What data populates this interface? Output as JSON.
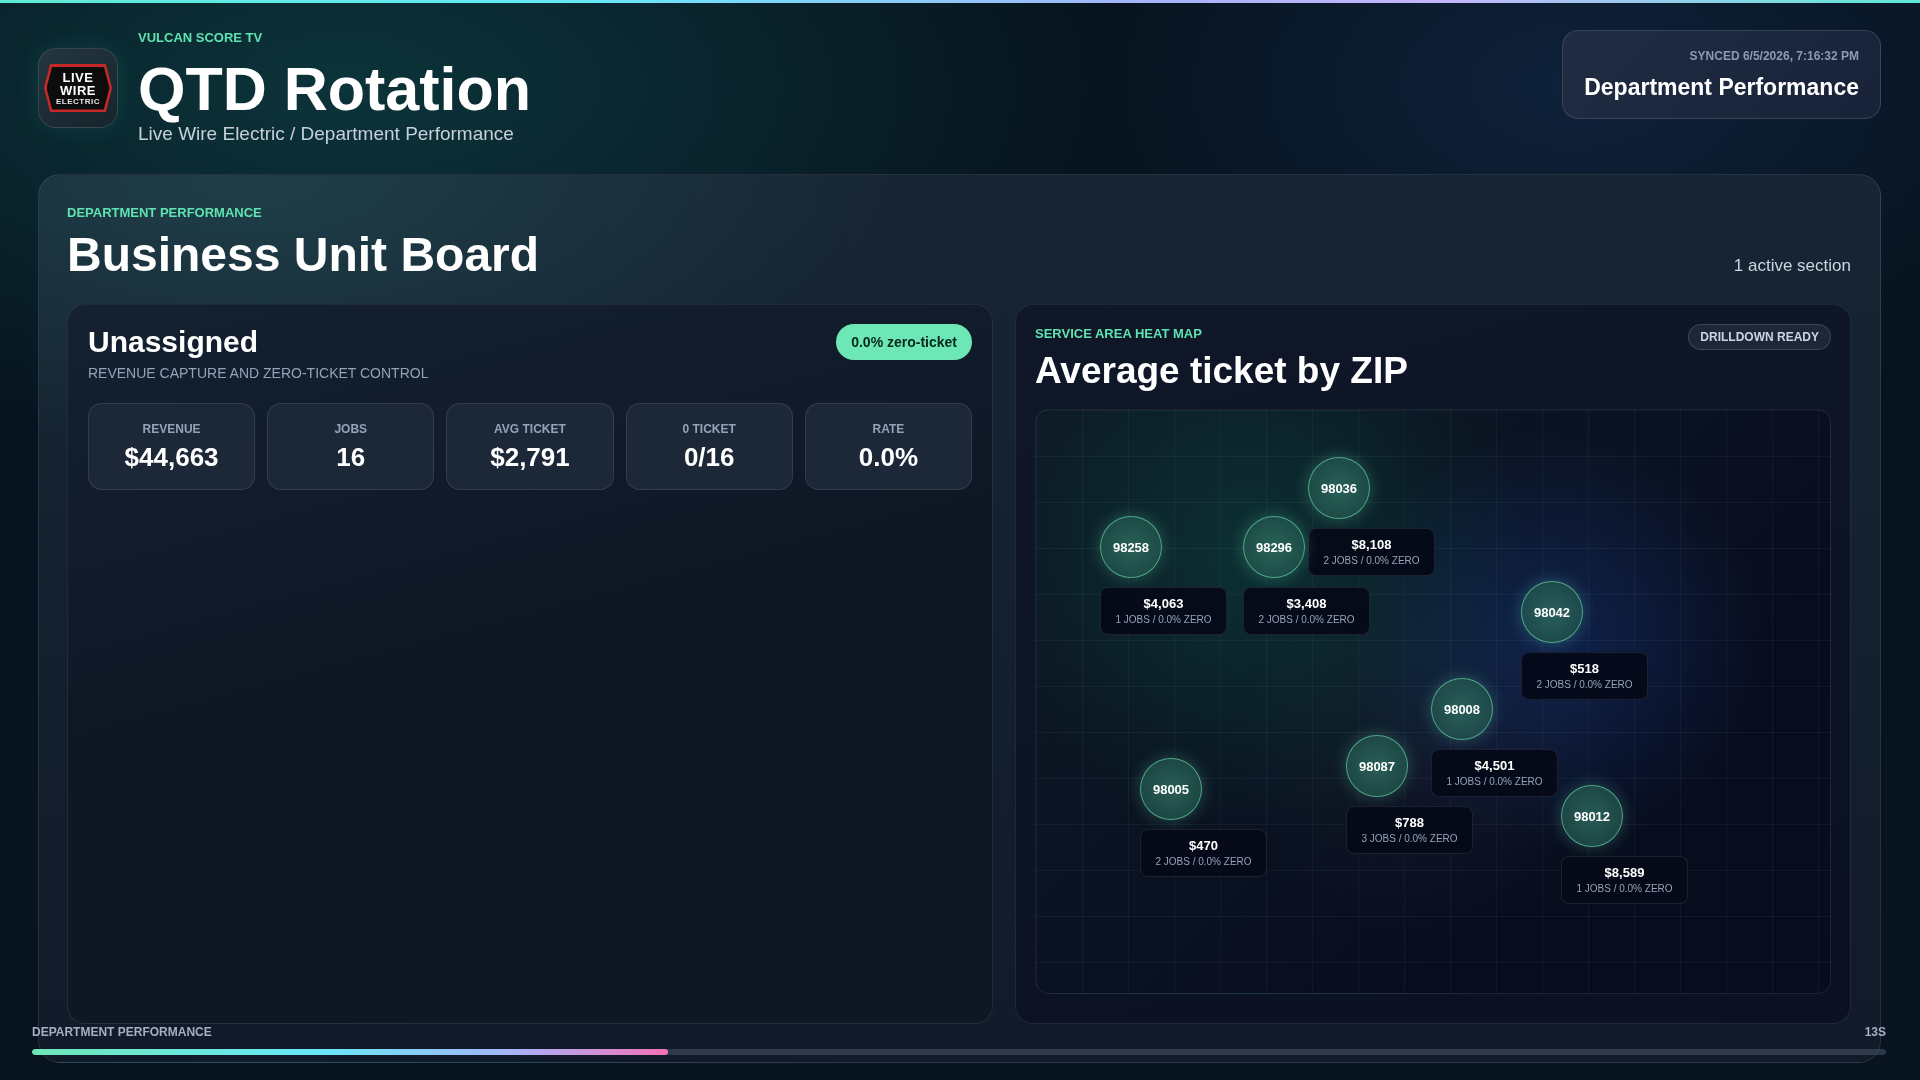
{
  "header": {
    "logo": {
      "lines": [
        "LIVE",
        "WIRE",
        "ELECTRIC"
      ]
    },
    "eyebrow": "VULCAN SCORE TV",
    "title": "QTD Rotation",
    "subtitle": "Live Wire Electric / Department Performance"
  },
  "sync_card": {
    "synced": "SYNCED 6/5/2026, 7:16:32 PM",
    "title": "Department Performance"
  },
  "board": {
    "eyebrow": "DEPARTMENT PERFORMANCE",
    "title": "Business Unit Board",
    "section_count": "1 active section",
    "unit_card": {
      "title": "Unassigned",
      "subtitle": "REVENUE CAPTURE AND ZERO-TICKET CONTROL",
      "badge": "0.0% zero-ticket",
      "stats": [
        {
          "label": "REVENUE",
          "value": "$44,663"
        },
        {
          "label": "JOBS",
          "value": "16"
        },
        {
          "label": "AVG TICKET",
          "value": "$2,791"
        },
        {
          "label": "0 TICKET",
          "value": "0/16"
        },
        {
          "label": "RATE",
          "value": "0.0%"
        }
      ]
    },
    "heat_map": {
      "eyebrow": "SERVICE AREA HEAT MAP",
      "title": "Average ticket by ZIP",
      "badge": "DRILLDOWN READY",
      "zips": [
        {
          "zip": "98036",
          "amount": "$8,108",
          "detail": "2 JOBS / 0.0% ZERO"
        },
        {
          "zip": "98258",
          "amount": "$4,063",
          "detail": "1 JOBS / 0.0% ZERO"
        },
        {
          "zip": "98296",
          "amount": "$3,408",
          "detail": "2 JOBS / 0.0% ZERO"
        },
        {
          "zip": "98042",
          "amount": "$518",
          "detail": "2 JOBS / 0.0% ZERO"
        },
        {
          "zip": "98008",
          "amount": "$4,501",
          "detail": "1 JOBS / 0.0% ZERO"
        },
        {
          "zip": "98087",
          "amount": "$788",
          "detail": "3 JOBS / 0.0% ZERO"
        },
        {
          "zip": "98005",
          "amount": "$470",
          "detail": "2 JOBS / 0.0% ZERO"
        },
        {
          "zip": "98012",
          "amount": "$8,589",
          "detail": "1 JOBS / 0.0% ZERO"
        }
      ]
    }
  },
  "footer": {
    "label": "DEPARTMENT PERFORMANCE",
    "countdown": "13S",
    "progress": {
      "level": 0.343
    }
  }
}
